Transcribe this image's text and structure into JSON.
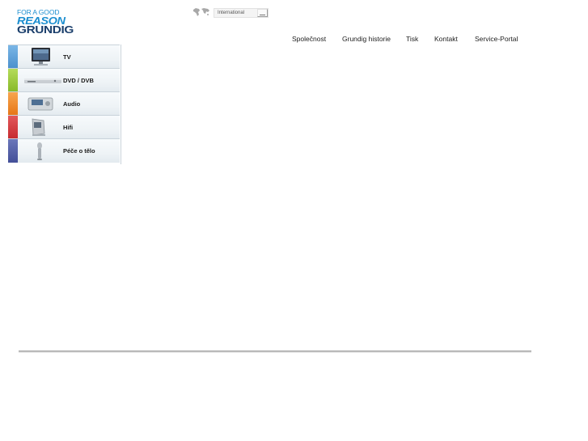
{
  "logo": {
    "tagline": "FOR A GOOD",
    "word": "REASON",
    "brand": "GRUNDIG",
    "color_primary": "#1d8fd0",
    "color_dark": "#1b3f6c"
  },
  "language_selector": {
    "icon": "globe-icon",
    "value": "International"
  },
  "topnav": {
    "items": [
      {
        "label": "Společnost"
      },
      {
        "label": "Grundig historie"
      },
      {
        "label": "Tisk"
      },
      {
        "label": "Kontakt"
      },
      {
        "label": "Service-Portal"
      }
    ]
  },
  "categories": [
    {
      "label": "TV",
      "icon": "tv-icon",
      "color": "#5aa0d8"
    },
    {
      "label": "DVD / DVB",
      "icon": "dvd-player-icon",
      "color": "#9ccc3a"
    },
    {
      "label": "Audio",
      "icon": "audio-device-icon",
      "color": "#f08a2a"
    },
    {
      "label": "Hifi",
      "icon": "hifi-speaker-icon",
      "color": "#d63a3e"
    },
    {
      "label": "Péče o tělo",
      "icon": "hair-dryer-icon",
      "color": "#5561a9"
    }
  ]
}
